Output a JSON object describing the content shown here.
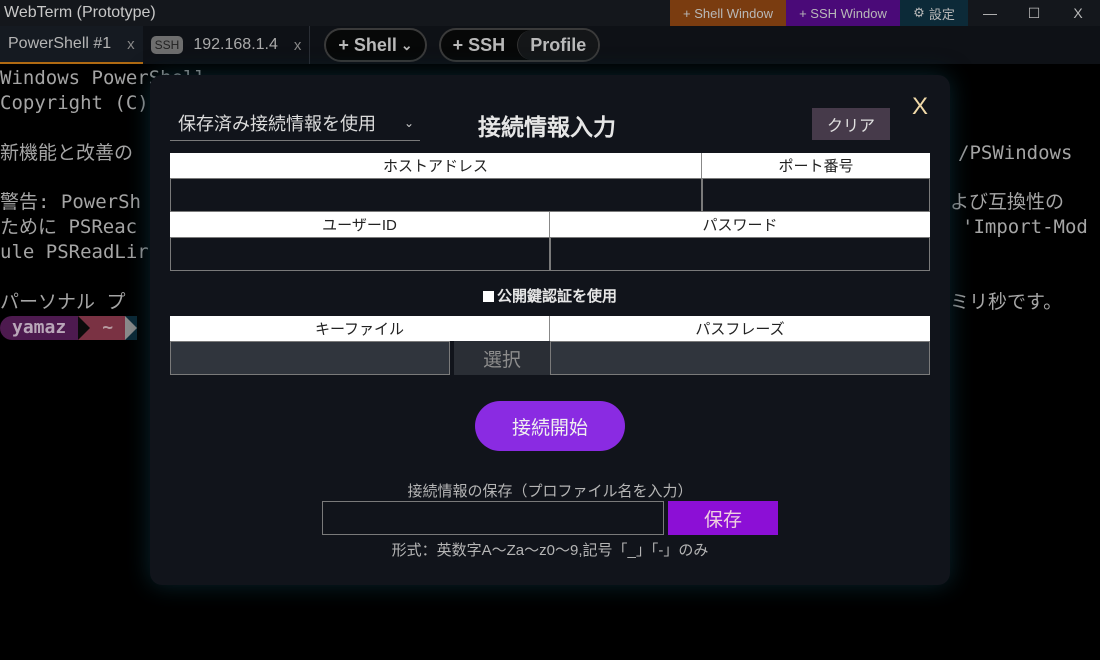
{
  "window": {
    "title": "WebTerm (Prototype)",
    "buttons": {
      "shell_window": "+ Shell Window",
      "ssh_window": "+ SSH Window",
      "settings": "設定",
      "minimize": "—",
      "maximize": "☐",
      "close": "X"
    }
  },
  "tabs": [
    {
      "label": "PowerShell #1",
      "close": "x",
      "active": true
    },
    {
      "badge": "SSH",
      "label": "192.168.1.4",
      "close": "x",
      "active": false
    }
  ],
  "toolbar": {
    "add_shell": "+ Shell",
    "add_ssh": "+ SSH",
    "profile": "Profile"
  },
  "terminal": {
    "lines": [
      "Windows PowerShell",
      "Copyright (C)",
      "",
      "新機能と改善の",
      "",
      "警告: PowerSh",
      "ために PSReac",
      "ule PSReadLir",
      "",
      "パーソナル プ"
    ],
    "right_fragments": {
      "line4": "/PSWindows",
      "line6": "よび互換性の",
      "line7": "'Import-Mod",
      "line10": "ミリ秒です。"
    },
    "prompt": {
      "user": "yamaz",
      "dir": "~"
    }
  },
  "dialog": {
    "saved_select": "保存済み接続情報を使用",
    "title": "接続情報入力",
    "clear": "クリア",
    "close": "X",
    "host_label": "ホストアドレス",
    "host_value": "",
    "port_label": "ポート番号",
    "port_value": "",
    "user_label": "ユーザーID",
    "user_value": "",
    "password_label": "パスワード",
    "password_value": "",
    "pubkey_label": "公開鍵認証を使用",
    "pubkey_checked": false,
    "keyfile_label": "キーファイル",
    "keyfile_value": "",
    "select_button": "選択",
    "passphrase_label": "パスフレーズ",
    "passphrase_value": "",
    "connect_button": "接続開始",
    "save_label": "接続情報の保存（プロファイル名を入力）",
    "profile_name_value": "",
    "save_button": "保存",
    "save_hint": "形式：英数字A～Za～z0～9,記号「_」「-」のみ"
  }
}
